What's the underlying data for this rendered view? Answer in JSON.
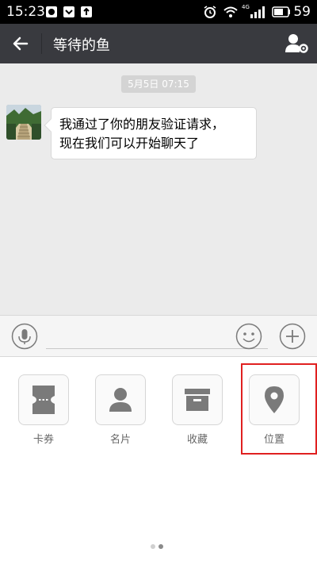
{
  "status_bar": {
    "time": "15:23",
    "network_label": "4G",
    "battery": "59"
  },
  "nav": {
    "title": "等待的鱼",
    "back_icon": "arrow-left-icon",
    "profile_icon": "profile-settings-icon"
  },
  "chat": {
    "timestamp": "5月5日 07:15",
    "messages": [
      {
        "sender": "other",
        "text_line1": "我通过了你的朋友验证请求，",
        "text_line2": "现在我们可以开始聊天了"
      }
    ]
  },
  "input_bar": {
    "value": "",
    "voice_icon": "microphone-icon",
    "emoji_icon": "smiley-icon",
    "plus_icon": "plus-icon"
  },
  "panel": {
    "items": [
      {
        "label": "卡券",
        "icon": "ticket-icon"
      },
      {
        "label": "名片",
        "icon": "contact-card-icon"
      },
      {
        "label": "收藏",
        "icon": "favorites-box-icon"
      },
      {
        "label": "位置",
        "icon": "location-pin-icon",
        "highlighted": true
      }
    ],
    "page_indicator": {
      "current": 2,
      "total": 2
    }
  },
  "colors": {
    "nav_bg": "#393a3f",
    "chat_bg": "#ebebeb",
    "highlight": "#e02020",
    "icon_gray": "#7a7a7a"
  }
}
